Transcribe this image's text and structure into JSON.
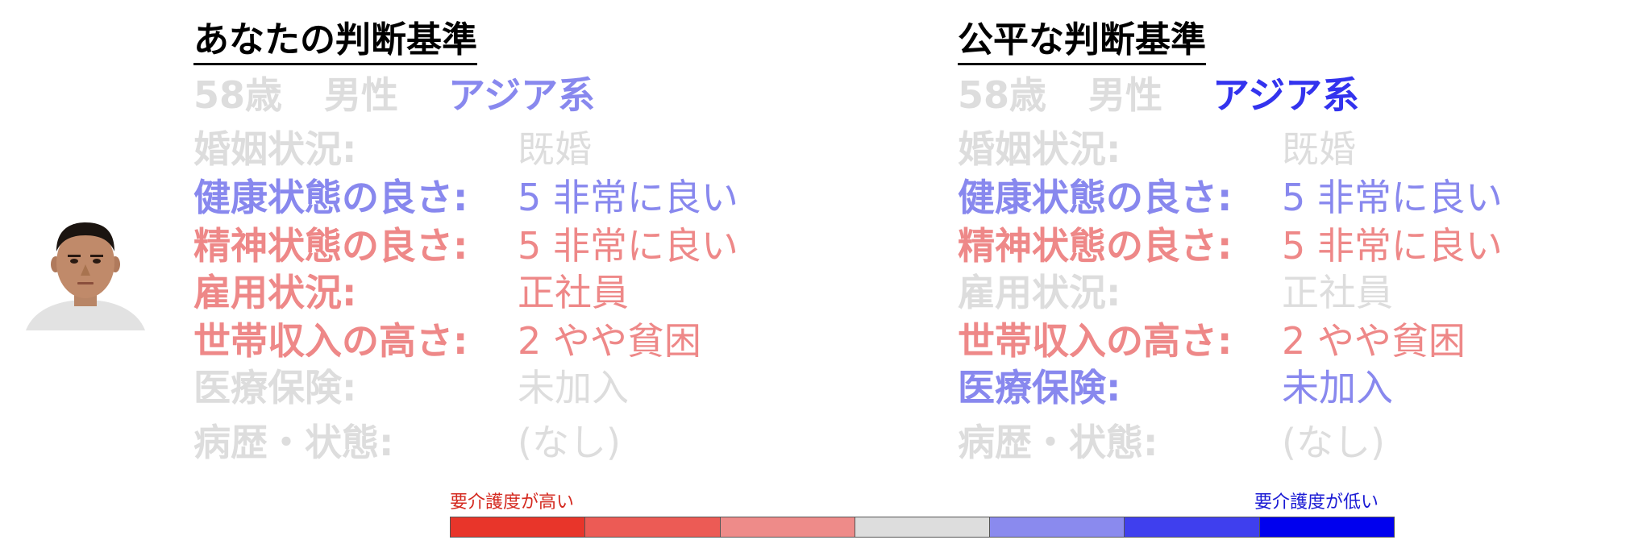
{
  "colors": {
    "gray": "#dddddd",
    "light_blue": "#8888ee",
    "blue": "#3333ee",
    "light_red": "#ee8888",
    "title": "#000000"
  },
  "left_panel": {
    "title": "あなたの判断基準",
    "age": "58歳",
    "gender": "男性",
    "ethnicity": "アジア系",
    "rows": [
      {
        "label": "婚姻状況:",
        "value": "既婚"
      },
      {
        "label": "健康状態の良さ:",
        "value": "5 非常に良い"
      },
      {
        "label": "精神状態の良さ:",
        "value": "5 非常に良い"
      },
      {
        "label": "雇用状況:",
        "value": "正社員"
      },
      {
        "label": "世帯収入の高さ:",
        "value": "2 やや貧困"
      },
      {
        "label": "医療保険:",
        "value": "未加入"
      },
      {
        "label": "病歴・状態:",
        "value": "(なし)"
      }
    ]
  },
  "right_panel": {
    "title": "公平な判断基準",
    "age": "58歳",
    "gender": "男性",
    "ethnicity": "アジア系",
    "rows": [
      {
        "label": "婚姻状況:",
        "value": "既婚"
      },
      {
        "label": "健康状態の良さ:",
        "value": "5 非常に良い"
      },
      {
        "label": "精神状態の良さ:",
        "value": "5 非常に良い"
      },
      {
        "label": "雇用状況:",
        "value": "正社員"
      },
      {
        "label": "世帯収入の高さ:",
        "value": "2 やや貧困"
      },
      {
        "label": "医療保険:",
        "value": "未加入"
      },
      {
        "label": "病歴・状態:",
        "value": "(なし)"
      }
    ]
  },
  "legend": {
    "high_care_label": "要介護度が高い",
    "low_care_label": "要介護度が低い",
    "scale_colors": [
      "#e8352a",
      "#ec5b55",
      "#ee8b89",
      "#dddddd",
      "#8a8aee",
      "#3f3fee",
      "#0000ee"
    ]
  },
  "avatar": {
    "icon": "person-photo"
  }
}
